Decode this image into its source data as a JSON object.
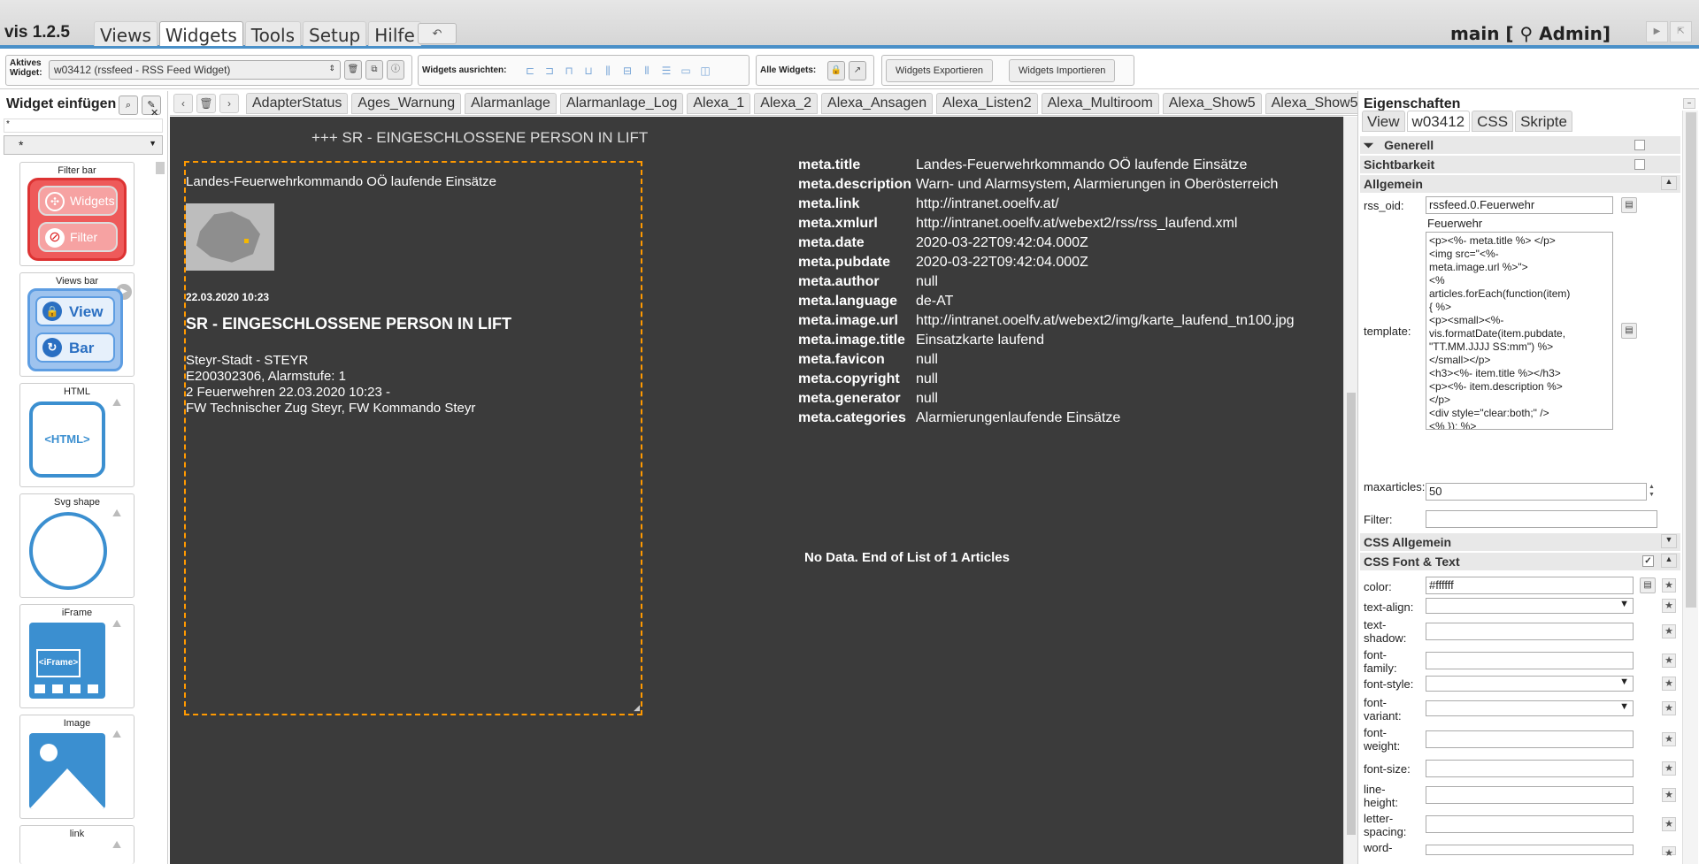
{
  "app": {
    "title": "vis 1.2.5",
    "menu": [
      "Views",
      "Widgets",
      "Tools",
      "Setup",
      "Hilfe"
    ],
    "undo": "↶",
    "user": "main [ ⚲ Admin]"
  },
  "toolbar": {
    "active_widget_label": "Aktives Widget:",
    "active_widget_value": "w03412 (rssfeed - RSS Feed Widget)",
    "align_label": "Widgets ausrichten:",
    "all_widgets_label": "Alle Widgets:",
    "export_label": "Widgets Exportieren",
    "import_label": "Widgets Importieren"
  },
  "left_panel": {
    "title": "Widget einfügen",
    "filter_value": "*",
    "set_select": "*",
    "widgets": [
      {
        "label": "Filter bar",
        "btn1": "Widgets",
        "btn2": "Filter"
      },
      {
        "label": "Views bar",
        "btn1": "View",
        "btn2": "Bar"
      },
      {
        "label": "HTML",
        "inner": "<HTML>"
      },
      {
        "label": "Svg shape"
      },
      {
        "label": "iFrame",
        "inner": "<iFrame>"
      },
      {
        "label": "Image"
      },
      {
        "label": "link"
      }
    ]
  },
  "view_tabs": [
    "AdapterStatus",
    "Ages_Warnung",
    "Alarmanlage",
    "Alarmanlage_Log",
    "Alexa_1",
    "Alexa_2",
    "Alexa_Ansagen",
    "Alexa_Listen2",
    "Alexa_Multiroom",
    "Alexa_Show5",
    "Alexa_Show5"
  ],
  "canvas": {
    "rss_header": "+++ SR - EINGESCHLOSSENE PERSON IN LIFT",
    "feed_title": "Landes-Feuerwehrkommando OÖ laufende Einsätze",
    "item_date": "22.03.2020 10:23",
    "item_title": "SR - EINGESCHLOSSENE PERSON IN LIFT",
    "item_lines": [
      "Steyr-Stadt - STEYR",
      "E200302306, Alarmstufe: 1",
      "2 Feuerwehren 22.03.2020 10:23 -",
      "FW Technischer Zug Steyr, FW Kommando Steyr"
    ],
    "meta": [
      {
        "k": "meta.title",
        "v": "Landes-Feuerwehrkommando OÖ laufende Einsätze"
      },
      {
        "k": "meta.description",
        "v": "Warn- und Alarmsystem, Alarmierungen in Oberösterreich"
      },
      {
        "k": "meta.link",
        "v": "http://intranet.ooelfv.at/"
      },
      {
        "k": "meta.xmlurl",
        "v": "http://intranet.ooelfv.at/webext2/rss/rss_laufend.xml"
      },
      {
        "k": "meta.date",
        "v": "2020-03-22T09:42:04.000Z"
      },
      {
        "k": "meta.pubdate",
        "v": "2020-03-22T09:42:04.000Z"
      },
      {
        "k": "meta.author",
        "v": "null"
      },
      {
        "k": "meta.language",
        "v": "de-AT"
      },
      {
        "k": "meta.image.url",
        "v": "http://intranet.ooelfv.at/webext2/img/karte_laufend_tn100.jpg"
      },
      {
        "k": "meta.image.title",
        "v": "Einsatzkarte laufend"
      },
      {
        "k": "meta.favicon",
        "v": "null"
      },
      {
        "k": "meta.copyright",
        "v": "null"
      },
      {
        "k": "meta.generator",
        "v": "null"
      },
      {
        "k": "meta.categories",
        "v": "Alarmierungenlaufende Einsätze"
      }
    ],
    "no_data": "No Data. End of List of 1 Articles"
  },
  "right_panel": {
    "title": "Eigenschaften",
    "tabs": [
      "View",
      "w03412",
      "CSS",
      "Skripte"
    ],
    "sections": {
      "generell": "Generell",
      "sichtbarkeit": "Sichtbarkeit",
      "allgemein": "Allgemein",
      "css_allgemein": "CSS Allgemein",
      "css_font": "CSS Font & Text"
    },
    "rss_oid_label": "rss_oid:",
    "rss_oid_value": "rssfeed.0.Feuerwehr",
    "rss_oid_hint": "Feuerwehr",
    "template_label": "template:",
    "template_value": "<p><%- meta.title %> </p>\n<img src=\"<%-\nmeta.image.url %>\">\n<%\narticles.forEach(function(item)\n{ %>\n<p><small><%-\nvis.formatDate(item.pubdate,\n\"TT.MM.JJJJ SS:mm\") %>\n</small></p>\n<h3><%- item.title %></h3>\n<p><%- item.description %>\n</p>\n<div style=\"clear:both;\" />\n<% }); %>",
    "maxarticles_label": "maxarticles:",
    "maxarticles_value": "50",
    "filter_label": "Filter:",
    "css": [
      {
        "label": "color:",
        "value": "#ffffff"
      },
      {
        "label": "text-align:",
        "value": ""
      },
      {
        "label": "text-shadow:",
        "value": ""
      },
      {
        "label": "font-family:",
        "value": ""
      },
      {
        "label": "font-style:",
        "value": ""
      },
      {
        "label": "font-variant:",
        "value": ""
      },
      {
        "label": "font-weight:",
        "value": ""
      },
      {
        "label": "font-size:",
        "value": ""
      },
      {
        "label": "line-height:",
        "value": ""
      },
      {
        "label": "letter-spacing:",
        "value": ""
      },
      {
        "label": "word-",
        "value": ""
      }
    ]
  },
  "colors": {
    "canvas": "#3b3b3b",
    "accent": "#4a90c8",
    "selection": "#ff9900"
  }
}
